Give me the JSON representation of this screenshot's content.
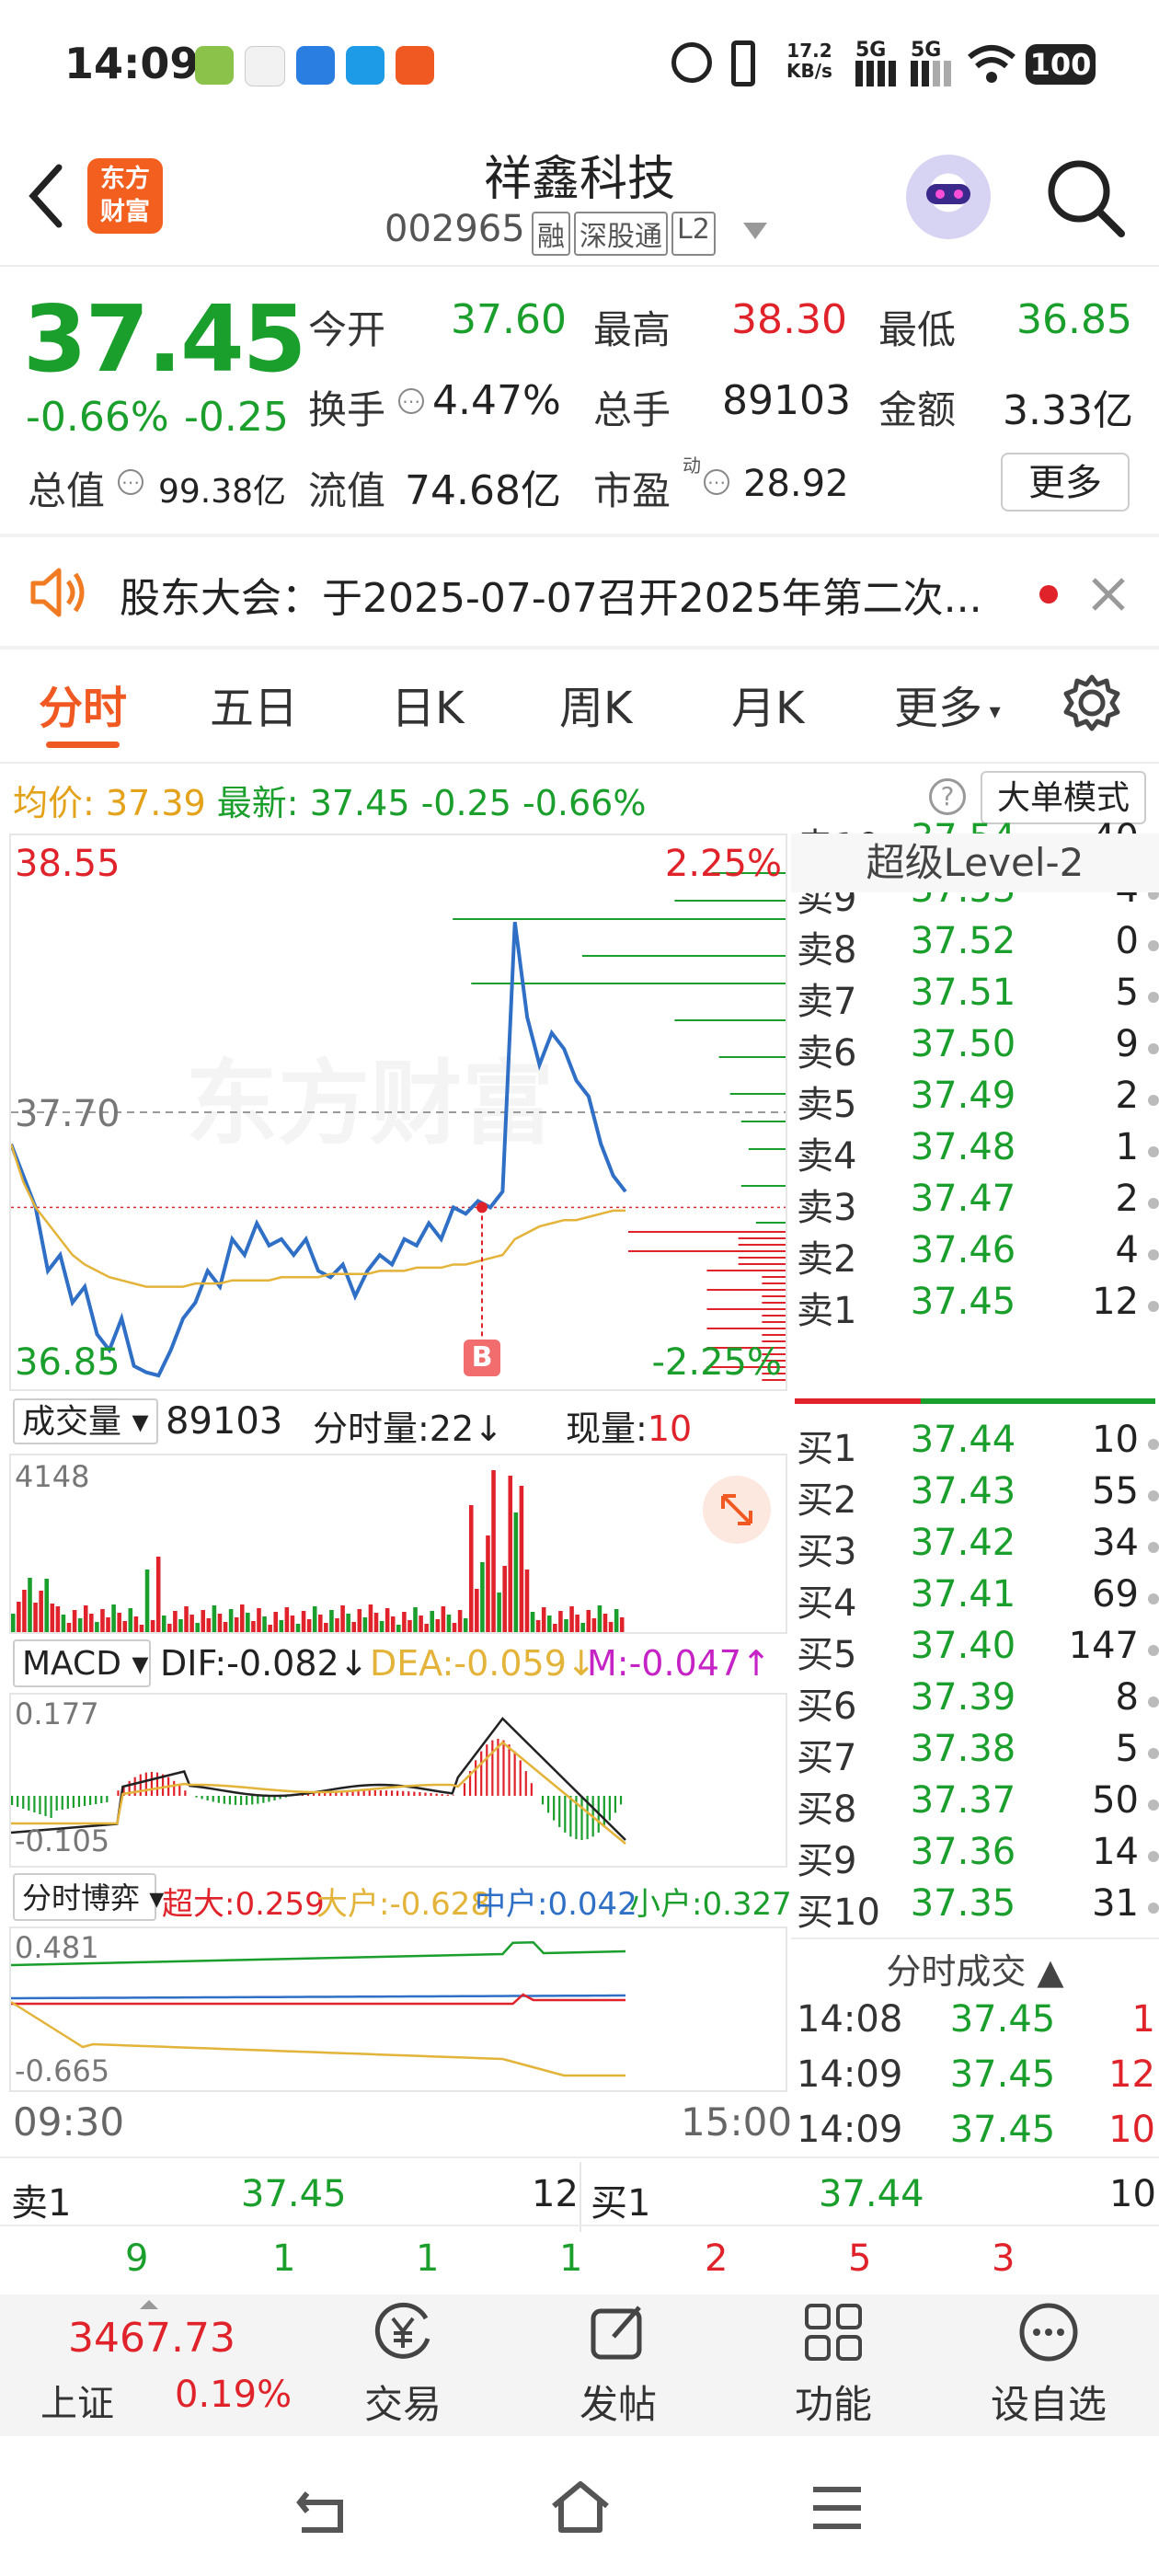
{
  "status_bar": {
    "time": "14:09",
    "net_speed_top": "17.2",
    "net_speed_bottom": "KB/s",
    "sig1": "5G",
    "sig2": "5G",
    "battery": "100"
  },
  "header": {
    "logo_line1": "东方",
    "logo_line2": "财富",
    "stock_name": "祥鑫科技",
    "stock_code": "002965",
    "tags": [
      "融",
      "深股通",
      "L2"
    ]
  },
  "quote": {
    "price": "37.45",
    "change_pct": "-0.66%",
    "change": "-0.25",
    "open_label": "今开",
    "open": "37.60",
    "high_label": "最高",
    "high": "38.30",
    "low_label": "最低",
    "low": "36.85",
    "turnover_label": "换手",
    "turnover": "4.47%",
    "volume_label": "总手",
    "volume": "89103",
    "amount_label": "金额",
    "amount": "3.33亿",
    "mktcap_label": "总值",
    "mktcap": "99.38亿",
    "float_label": "流值",
    "float": "74.68亿",
    "pe_label": "市盈",
    "pe_sup": "动",
    "pe": "28.92",
    "more_button": "更多"
  },
  "notice": {
    "text": "股东大会：于2025-07-07召开2025年第二次..."
  },
  "tabs": [
    "分时",
    "五日",
    "日K",
    "周K",
    "月K",
    "更多"
  ],
  "avg_bar": {
    "avg_label": "均价:",
    "avg": "37.39",
    "latest_label": "最新:",
    "latest": "37.45",
    "chg": "-0.25",
    "chg_pct": "-0.66%",
    "big_order_button": "大单模式"
  },
  "chart_data": [
    {
      "type": "line",
      "name": "分时",
      "y_top_label": "38.55",
      "y_mid_label": "37.70",
      "y_bottom_label": "36.85",
      "pct_top_label": "2.25%",
      "pct_bottom_label": "-2.25%",
      "ylim": [
        36.85,
        38.55
      ],
      "x_start_label": "09:30",
      "x_end_label": "15:00",
      "marker": "B",
      "series": [
        {
          "name": "price",
          "color": "#2f6fc6",
          "values": [
            37.6,
            37.5,
            37.4,
            37.2,
            37.25,
            37.1,
            37.15,
            37.0,
            36.95,
            37.05,
            36.9,
            36.88,
            36.87,
            36.95,
            37.05,
            37.1,
            37.2,
            37.15,
            37.3,
            37.25,
            37.35,
            37.28,
            37.3,
            37.25,
            37.3,
            37.2,
            37.18,
            37.22,
            37.12,
            37.2,
            37.25,
            37.22,
            37.3,
            37.28,
            37.35,
            37.3,
            37.4,
            37.38,
            37.42,
            37.4,
            37.45,
            38.3,
            38.0,
            37.85,
            37.95,
            37.9,
            37.8,
            37.75,
            37.6,
            37.5,
            37.45
          ]
        },
        {
          "name": "avg",
          "color": "#e3b33a",
          "values": [
            37.6,
            37.48,
            37.4,
            37.35,
            37.3,
            37.25,
            37.22,
            37.2,
            37.18,
            37.17,
            37.16,
            37.15,
            37.15,
            37.15,
            37.15,
            37.16,
            37.16,
            37.16,
            37.17,
            37.17,
            37.17,
            37.17,
            37.18,
            37.18,
            37.18,
            37.18,
            37.19,
            37.19,
            37.19,
            37.19,
            37.2,
            37.2,
            37.2,
            37.21,
            37.21,
            37.21,
            37.22,
            37.22,
            37.23,
            37.24,
            37.25,
            37.3,
            37.32,
            37.34,
            37.35,
            37.36,
            37.36,
            37.37,
            37.38,
            37.39,
            37.39
          ]
        }
      ]
    }
  ],
  "level2_title": "超级Level-2",
  "asks": [
    {
      "label": "卖10",
      "price": "37.54",
      "qty": "40"
    },
    {
      "label": "卖9",
      "price": "37.53",
      "qty": "4"
    },
    {
      "label": "卖8",
      "price": "37.52",
      "qty": "0"
    },
    {
      "label": "卖7",
      "price": "37.51",
      "qty": "5"
    },
    {
      "label": "卖6",
      "price": "37.50",
      "qty": "9"
    },
    {
      "label": "卖5",
      "price": "37.49",
      "qty": "2"
    },
    {
      "label": "卖4",
      "price": "37.48",
      "qty": "1"
    },
    {
      "label": "卖3",
      "price": "37.47",
      "qty": "2"
    },
    {
      "label": "卖2",
      "price": "37.46",
      "qty": "4"
    },
    {
      "label": "卖1",
      "price": "37.45",
      "qty": "12"
    }
  ],
  "bids": [
    {
      "label": "买1",
      "price": "37.44",
      "qty": "10"
    },
    {
      "label": "买2",
      "price": "37.43",
      "qty": "55"
    },
    {
      "label": "买3",
      "price": "37.42",
      "qty": "34"
    },
    {
      "label": "买4",
      "price": "37.41",
      "qty": "69"
    },
    {
      "label": "买5",
      "price": "37.40",
      "qty": "147"
    },
    {
      "label": "买6",
      "price": "37.39",
      "qty": "8"
    },
    {
      "label": "买7",
      "price": "37.38",
      "qty": "5"
    },
    {
      "label": "买8",
      "price": "37.37",
      "qty": "50"
    },
    {
      "label": "买9",
      "price": "37.36",
      "qty": "14"
    },
    {
      "label": "买10",
      "price": "37.35",
      "qty": "31"
    }
  ],
  "volume": {
    "label": "成交量",
    "total": "89103",
    "tick_label": "分时量:22↓",
    "cur_label": "现量:",
    "cur": "10",
    "max_label": "4148"
  },
  "macd": {
    "label": "MACD",
    "dif": "DIF:-0.082↓",
    "dea": "DEA:-0.059↓",
    "m": "M:-0.047↑",
    "top": "0.177",
    "bottom": "-0.105"
  },
  "flow": {
    "label": "分时博弈",
    "super": "超大:0.259",
    "big": "大户:-0.628",
    "mid": "中户:0.042",
    "small": "小户:0.327",
    "top": "0.481",
    "bottom": "-0.665"
  },
  "trades_title": "分时成交",
  "trades": [
    {
      "time": "14:08",
      "price": "37.45",
      "qty": "1"
    },
    {
      "time": "14:09",
      "price": "37.45",
      "qty": "12"
    },
    {
      "time": "14:09",
      "price": "37.45",
      "qty": "10"
    }
  ],
  "bottom_quote": {
    "sell_label": "卖1",
    "sell_price": "37.45",
    "sell_qty": "12",
    "buy_label": "买1",
    "buy_price": "37.44",
    "buy_qty": "10",
    "sell_splits": [
      "9",
      "1",
      "1",
      "1"
    ],
    "buy_splits": [
      "2",
      "5",
      "3"
    ]
  },
  "index": {
    "value": "3467.73",
    "name": "上证",
    "chg": "0.19%"
  },
  "nav": [
    "交易",
    "发帖",
    "功能",
    "设自选"
  ]
}
